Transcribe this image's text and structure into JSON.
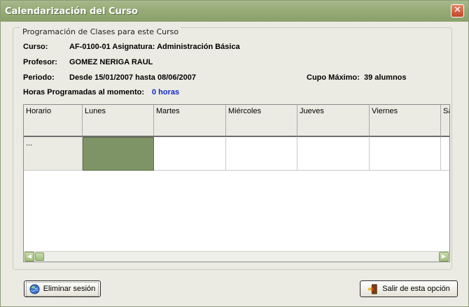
{
  "window": {
    "title": "Calendarización del Curso",
    "close_symbol": "✕"
  },
  "group": {
    "legend": "Programación de Clases para este Curso"
  },
  "course": {
    "curso_label": "Curso:",
    "curso_value": "AF-0100-01 Asignatura: Administración Básica",
    "profesor_label": "Profesor:",
    "profesor_value": "GOMEZ NERIGA RAUL",
    "periodo_label": "Periodo:",
    "periodo_value": "Desde 15/01/2007 hasta 08/06/2007",
    "cupo_label": "Cupo Máximo:",
    "cupo_value": "39 alumnos",
    "horas_label": "Horas Programadas al momento:",
    "horas_value": "0 horas"
  },
  "schedule": {
    "columns": [
      "Horario",
      "Lunes",
      "Martes",
      "Miércoles",
      "Jueves",
      "Viernes",
      "Sá"
    ],
    "rows": [
      {
        "horario": "..."
      }
    ],
    "selected_cell_color": "#7f9466"
  },
  "buttons": {
    "eliminar": "Eliminar sesión",
    "eliminar_icon": "globe-icon",
    "salir": "Salir de esta opción",
    "salir_icon": "exit-door-icon"
  },
  "colors": {
    "titlebar": "#98ac78",
    "window_bg": "#ecebe3",
    "accent_text": "#1028c8"
  }
}
